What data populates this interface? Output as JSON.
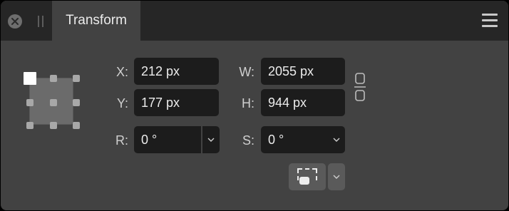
{
  "panel": {
    "tab_title": "Transform",
    "icons": {
      "close": "close-icon",
      "grip": "grip-icon",
      "menu": "hamburger-menu-icon"
    }
  },
  "transform": {
    "x": {
      "label": "X:",
      "value": "212 px"
    },
    "y": {
      "label": "Y:",
      "value": "177 px"
    },
    "w": {
      "label": "W:",
      "value": "2055 px"
    },
    "h": {
      "label": "H:",
      "value": "944 px"
    },
    "r": {
      "label": "R:",
      "value": "0 °"
    },
    "s": {
      "label": "S:",
      "value": "0 °"
    },
    "anchor": "top-left",
    "aspect_lock_icon": "chain-link-icon",
    "snap_icon": "bounding-box-icon"
  },
  "colors": {
    "panel_bg": "#424242",
    "header_bg": "#262626",
    "field_bg": "#1c1c1c",
    "text": "#ececec"
  }
}
